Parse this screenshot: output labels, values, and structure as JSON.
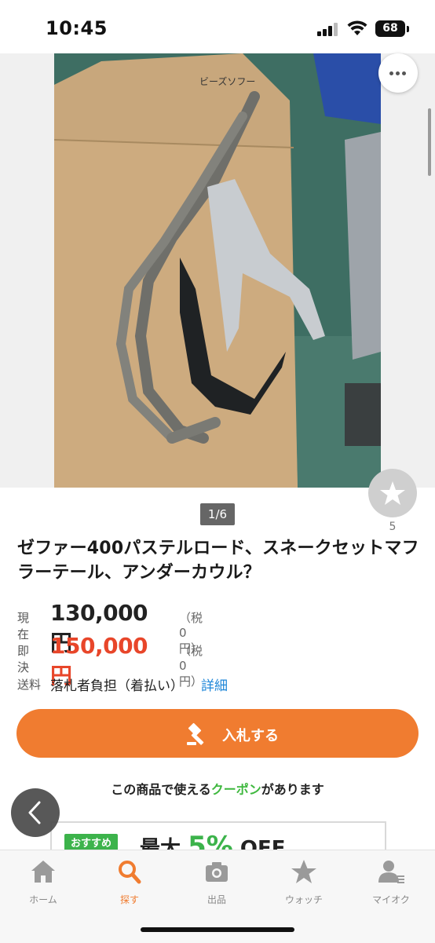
{
  "status_bar": {
    "time": "10:45",
    "battery": "68",
    "icons": [
      "cellular-signal-icon",
      "wifi-icon",
      "battery-icon"
    ]
  },
  "photo": {
    "description_icon": "product-photo",
    "page_indicator": "1/6"
  },
  "watch": {
    "icon": "star-icon",
    "count": "5"
  },
  "item": {
    "title": "ゼファー400パステルロード、スネークセットマフラーテール、アンダーカウル？"
  },
  "price": {
    "current_label": "現在",
    "current_value": "130,000円",
    "current_tax": "（税 0円）",
    "buyout_label": "即決",
    "buyout_value": "150,000円",
    "buyout_tax": "（税 0円）"
  },
  "shipping": {
    "label": "送料",
    "value": "落札者負担（着払い）",
    "detail_link": "詳細"
  },
  "bid_button": {
    "label": "入札する",
    "icon": "gavel-icon"
  },
  "coupon": {
    "prefix": "この商品で使える",
    "highlight": "クーポン",
    "suffix": "があります",
    "badge": "おすすめ",
    "headline_prefix": "最大",
    "headline_pct": "5%",
    "headline_suffix": "OFF"
  },
  "bottom_nav": {
    "items": [
      {
        "label": "ホーム",
        "icon": "home-icon"
      },
      {
        "label": "探す",
        "icon": "search-icon"
      },
      {
        "label": "出品",
        "icon": "camera-icon"
      },
      {
        "label": "ウォッチ",
        "icon": "star-icon"
      },
      {
        "label": "マイオク",
        "icon": "user-icon"
      }
    ]
  },
  "colors": {
    "accent": "#f07c30",
    "buyout_price": "#e8462a",
    "link": "#1d86d8",
    "coupon_green": "#3cb34b"
  }
}
